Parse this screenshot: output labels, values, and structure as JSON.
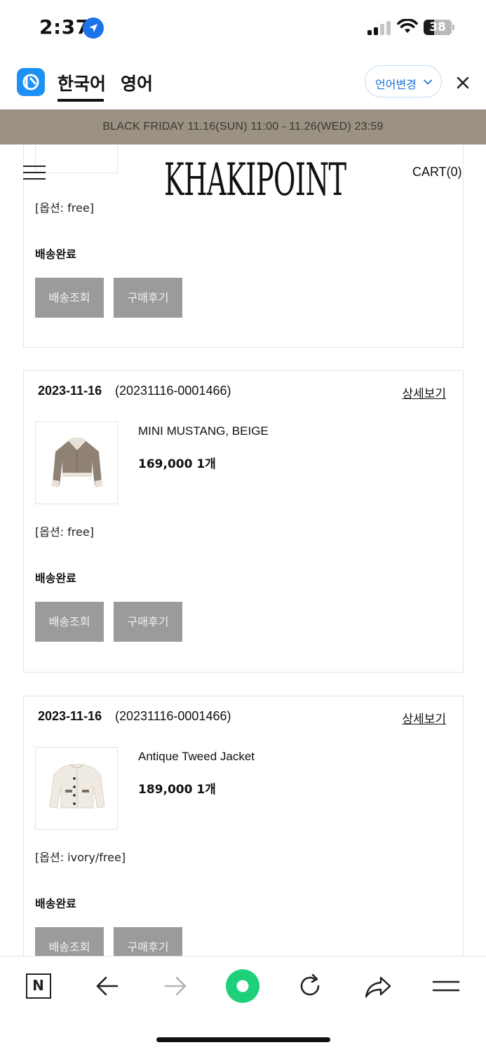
{
  "status_bar": {
    "time": "2:37",
    "battery": "38",
    "battery_level_percent": 38,
    "icons": [
      "location-arrow-icon",
      "cellular-signal-icon",
      "wifi-icon",
      "battery-icon"
    ]
  },
  "translation_bar": {
    "tab_korean": "한국어",
    "tab_english": "영어",
    "change_language": "언어변경",
    "accent_color": "#1c74d8"
  },
  "banner": {
    "text": "BLACK FRIDAY 11.16(SUN) 11:00 - 11.26(WED) 23:59",
    "background": "#9b9283"
  },
  "header": {
    "logo": "KHAKIPOINT",
    "cart": "CART(0)"
  },
  "orders": [
    {
      "option": "[옵션: free]",
      "status": "배송완료",
      "track_label": "배송조회",
      "review_label": "구매후기"
    },
    {
      "date": "2023-11-16",
      "order_no": "(20231116-0001466)",
      "detail_label": "상세보기",
      "product_name": "MINI MUSTANG, BEIGE",
      "price": "169,000 1개",
      "option": "[옵션: free]",
      "status": "배송완료",
      "track_label": "배송조회",
      "review_label": "구매후기"
    },
    {
      "date": "2023-11-16",
      "order_no": "(20231116-0001466)",
      "detail_label": "상세보기",
      "product_name": "Antique Tweed Jacket",
      "price": "189,000 1개",
      "option": "[옵션: ivory/free]",
      "status": "배송완료",
      "track_label": "배송조회",
      "review_label": "구매후기"
    }
  ],
  "colors": {
    "button_gray": "#9b9b9b",
    "go_button_green": "#1fd07a"
  },
  "toolbar": {
    "naver_letter": "N",
    "icons": [
      "naver-home-icon",
      "back-arrow-icon",
      "forward-arrow-icon",
      "green-dot-icon",
      "refresh-icon",
      "share-icon",
      "menu-icon"
    ]
  }
}
